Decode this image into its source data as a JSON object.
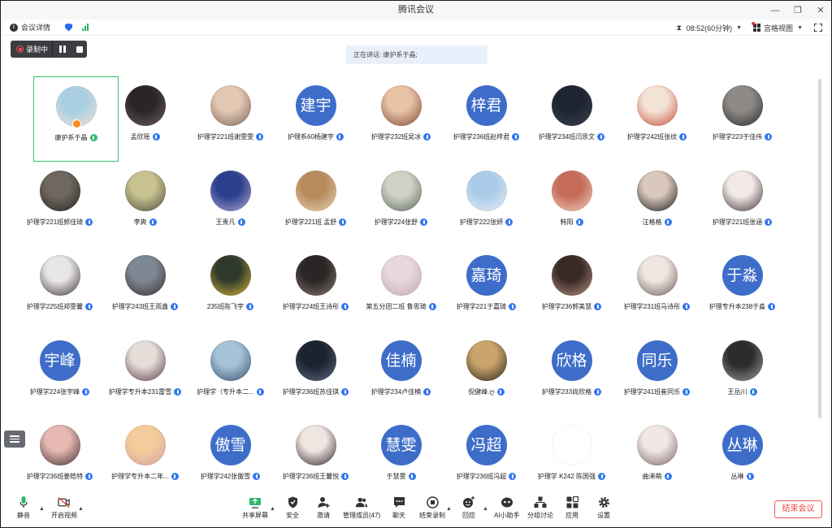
{
  "window": {
    "title": "腾讯会议"
  },
  "infobar": {
    "meeting_details": "会议详情",
    "timer": "08:52(60分钟)",
    "view_mode": "宫格视图"
  },
  "recording": {
    "label": "录制中"
  },
  "speaking": {
    "text": "正在讲话: 康护系于晶;"
  },
  "colors": {
    "accent": "#3e6dc9",
    "active_border": "#32c266",
    "end_button": "#e8483c"
  },
  "participants": [
    {
      "name": "康护系于晶",
      "avatar_text": "",
      "photo": "#a9cfe1,#f2e2d5",
      "mic": "green"
    },
    {
      "name": "孟欣瑶",
      "avatar_text": "",
      "photo": "#2a2628,#6d5c60",
      "mic": "blue"
    },
    {
      "name": "护理学221班谢雯雯",
      "avatar_text": "",
      "photo": "#e3c9b4,#7a6355",
      "mic": "blue"
    },
    {
      "name": "护理系60杨建宇",
      "avatar_text": "建宇",
      "photo": "",
      "mic": "blue"
    },
    {
      "name": "护理学232班吴冰",
      "avatar_text": "",
      "photo": "#e9c3a6,#7b4a35",
      "mic": "blue"
    },
    {
      "name": "护理学236班赵梓君",
      "avatar_text": "梓君",
      "photo": "",
      "mic": "blue"
    },
    {
      "name": "护理学234班闫思文",
      "avatar_text": "",
      "photo": "#1f2530,#39404d",
      "mic": "blue"
    },
    {
      "name": "护理学242班张纹",
      "avatar_text": "",
      "photo": "#f3e3d4,#c94d3a",
      "mic": "blue"
    },
    {
      "name": "护理学223于佳伟",
      "avatar_text": "",
      "photo": "#8d8a88,#2e2b2a",
      "mic": "blue"
    },
    {
      "name": "护理学221班郭佳琦",
      "avatar_text": "",
      "photo": "#6f6860,#2a2422",
      "mic": "blue"
    },
    {
      "name": "李爽",
      "avatar_text": "",
      "photo": "#c8c290,#4c4d3a",
      "mic": "blue"
    },
    {
      "name": "王贵凡",
      "avatar_text": "",
      "photo": "#2b3f8c,#b3a8d6",
      "mic": "blue"
    },
    {
      "name": "护理学221班 孟舒",
      "avatar_text": "",
      "photo": "#b78b5c,#e8d3b3",
      "mic": "blue"
    },
    {
      "name": "护理学224张舒",
      "avatar_text": "",
      "photo": "#d0d2c6,#5a6a5e",
      "mic": "blue"
    },
    {
      "name": "护理学222张妍",
      "avatar_text": "",
      "photo": "#aacbe8,#e8eef4",
      "mic": "blue"
    },
    {
      "name": "韩阳",
      "avatar_text": "",
      "photo": "#c56b5a,#efd1bb",
      "mic": "blue"
    },
    {
      "name": "汪格格",
      "avatar_text": "",
      "photo": "#d9c8bb,#1c1a1b",
      "mic": "blue"
    },
    {
      "name": "护理学221班张涵",
      "avatar_text": "",
      "photo": "#f2eae6,#3a3236",
      "mic": "blue"
    },
    {
      "name": "护理学225班郑雯馨",
      "avatar_text": "",
      "photo": "#e8e6e4,#3b3636",
      "mic": "blue"
    },
    {
      "name": "护理学243班王雨鑫",
      "avatar_text": "",
      "photo": "#7e8895,#3b2f2c",
      "mic": "blue"
    },
    {
      "name": "235班陈飞宇",
      "avatar_text": "",
      "photo": "#2f3a2d,#d8b73c",
      "mic": "blue"
    },
    {
      "name": "护理学224班王诗彤",
      "avatar_text": "",
      "photo": "#2a2626,#8a7a72",
      "mic": "blue"
    },
    {
      "name": "第五分团二班 鲁思琦",
      "avatar_text": "",
      "photo": "#e8d7dc,#c1a7b5",
      "mic": "blue"
    },
    {
      "name": "护理学221于嘉琦",
      "avatar_text": "嘉琦",
      "photo": "",
      "mic": "blue"
    },
    {
      "name": "护理学236郭美慧",
      "avatar_text": "",
      "photo": "#3a2a26,#b59383",
      "mic": "blue"
    },
    {
      "name": "护理学231班马诗彤",
      "avatar_text": "",
      "photo": "#efe5e1,#6d5f5a",
      "mic": "blue"
    },
    {
      "name": "护理专升本238于淼",
      "avatar_text": "于淼",
      "photo": "",
      "mic": "blue"
    },
    {
      "name": "护理学224张宇峰",
      "avatar_text": "宇峰",
      "photo": "",
      "mic": "blue"
    },
    {
      "name": "护理学专升本231雷雪",
      "avatar_text": "",
      "photo": "#e5ded8,#5b3c47",
      "mic": "blue"
    },
    {
      "name": "护理学（专升本二...",
      "avatar_text": "",
      "photo": "#a4c3d9,#35506b",
      "mic": "blue"
    },
    {
      "name": "护理学236班苏佳琪",
      "avatar_text": "",
      "photo": "#1c2330,#5c6a80",
      "mic": "blue"
    },
    {
      "name": "护理学234卢佳楠",
      "avatar_text": "佳楠",
      "photo": "",
      "mic": "blue"
    },
    {
      "name": "倪健峰.ღ",
      "avatar_text": "",
      "photo": "#caa56b,#2a231d",
      "mic": "blue"
    },
    {
      "name": "护理学233尚欣格",
      "avatar_text": "欣格",
      "photo": "",
      "mic": "blue"
    },
    {
      "name": "护理学241班崔同乐",
      "avatar_text": "同乐",
      "photo": "",
      "mic": "blue"
    },
    {
      "name": "王岳川",
      "avatar_text": "",
      "photo": "#2c2b2d,#a49e9a",
      "mic": "blue"
    },
    {
      "name": "护理学236班姜皓特",
      "avatar_text": "",
      "photo": "#e7b9b2,#3c2c30",
      "mic": "blue"
    },
    {
      "name": "护理学专升本二年...",
      "avatar_text": "",
      "photo": "#f2cc9a,#d6a3a3",
      "mic": "blue"
    },
    {
      "name": "护理学242张傲雪",
      "avatar_text": "傲雪",
      "photo": "",
      "mic": "blue"
    },
    {
      "name": "护理学236班王馨悦",
      "avatar_text": "",
      "photo": "#efe6e2,#2d2526",
      "mic": "blue"
    },
    {
      "name": "于慧雯",
      "avatar_text": "慧雯",
      "photo": "",
      "mic": "blue"
    },
    {
      "name": "护理学236班冯超",
      "avatar_text": "冯超",
      "photo": "",
      "mic": "blue"
    },
    {
      "name": "护理学 K242 陈国强",
      "avatar_text": "",
      "photo": "#ffffff,#ffffff",
      "mic": "blue"
    },
    {
      "name": "曲浠萌",
      "avatar_text": "",
      "photo": "#f1e7e4,#7a6266",
      "mic": "blue"
    },
    {
      "name": "丛琳",
      "avatar_text": "丛琳",
      "photo": "",
      "mic": "blue"
    }
  ],
  "toolbar": {
    "mute": "静音",
    "video": "开启视频",
    "share": "共享屏幕",
    "security": "安全",
    "invite": "邀请",
    "members": "管理成员(47)",
    "chat": "聊天",
    "end_recording": "结束录制",
    "reactions": "回应",
    "ai": "AI小助手",
    "breakout": "分组讨论",
    "apps": "应用",
    "settings": "设置",
    "end_meeting": "结束会议"
  }
}
